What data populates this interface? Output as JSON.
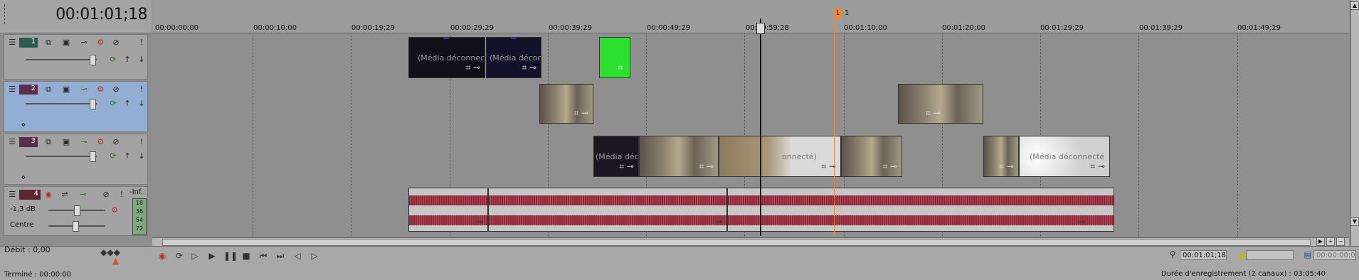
{
  "header": {
    "timecode": "00:01:01;18"
  },
  "ruler": {
    "ticks": [
      "00:00:00;00",
      "00:00:10;00",
      "00:00:19;29",
      "00:00:29;29",
      "00:00:39;29",
      "00:00:49;29",
      "00:00:59;28",
      "00:01:10;00",
      "00:01:20;00",
      "00:01:29;29",
      "00:01:39;29",
      "00:01:49;29"
    ],
    "marker": {
      "flag": "1",
      "label": "1"
    }
  },
  "tracks": [
    {
      "number": "1",
      "type": "video"
    },
    {
      "number": "2",
      "type": "video"
    },
    {
      "number": "3",
      "type": "video"
    },
    {
      "number": "4",
      "type": "audio",
      "volume": "-1,3 dB",
      "pan": "Centre",
      "meter_top": "-Inf.",
      "meter_scale": [
        "18",
        "36",
        "54",
        "72"
      ]
    }
  ],
  "clips": {
    "offline_title": "(Média déconnecté)",
    "offline_title_short": "(Média déconnec",
    "offline_title_partial": "(Média déconnecté",
    "offline_title_clipped": "onnecté)"
  },
  "transport": {
    "rate": "Débit : 0,00",
    "status": "Terminé : 00:00:00",
    "cursor_time": "00:01:01;18",
    "selection_end": "00:00:00;0",
    "record_info": "Durée d'enregistrement (2 canaux) : 03:05:40"
  },
  "colors": {
    "video_track": "#2c5c50",
    "audio_track": "#5b2630",
    "marker": "#e7893e",
    "selected_header": "#93aed2"
  }
}
